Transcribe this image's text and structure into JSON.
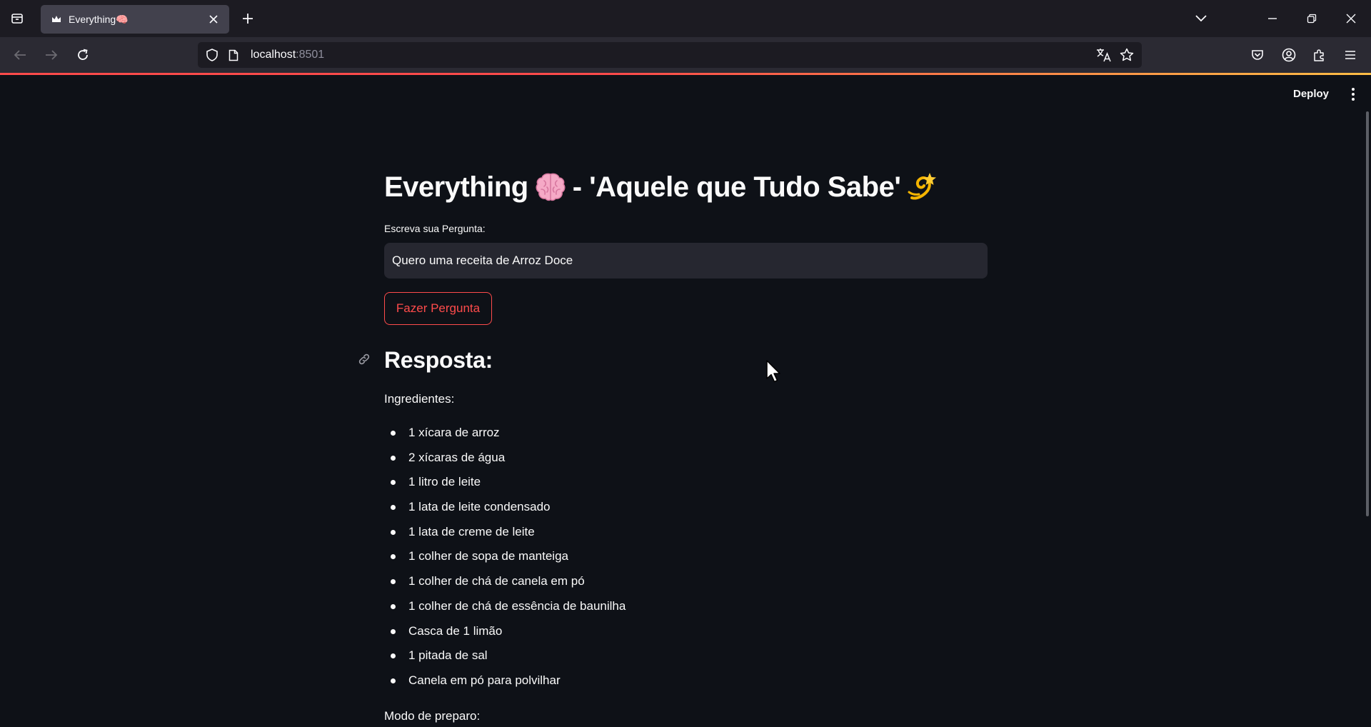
{
  "browser": {
    "tab_title": "Everything🧠",
    "url_host": "localhost",
    "url_port": ":8501"
  },
  "app": {
    "deploy_label": "Deploy",
    "title_part1": "Everything",
    "title_part2": " - 'Aquele que Tudo Sabe'",
    "input_label": "Escreva sua Pergunta:",
    "input_value": "Quero uma receita de Arroz Doce",
    "button_label": "Fazer Pergunta",
    "response_heading": "Resposta:",
    "ingredients_label": "Ingredientes:",
    "ingredients": [
      "1 xícara de arroz",
      "2 xícaras de água",
      "1 litro de leite",
      "1 lata de leite condensado",
      "1 lata de creme de leite",
      "1 colher de sopa de manteiga",
      "1 colher de chá de canela em pó",
      "1 colher de chá de essência de baunilha",
      "Casca de 1 limão",
      "1 pitada de sal",
      "Canela em pó para polvilhar"
    ],
    "prep_label": "Modo de preparo:"
  },
  "icons": {
    "title_emoji_1": "brain-emoji",
    "title_emoji_2": "dizzy-emoji"
  },
  "colors": {
    "background": "#0e1117",
    "accent": "#ff4b4b",
    "input_background": "#262730"
  }
}
